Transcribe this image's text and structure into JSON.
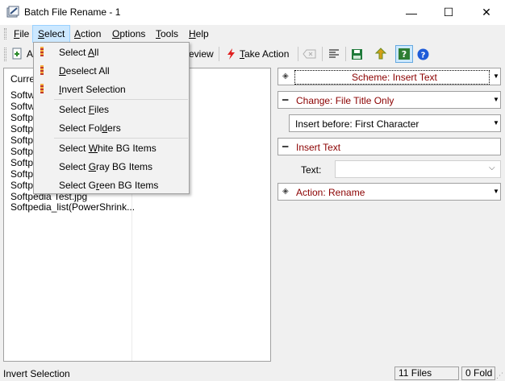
{
  "window": {
    "title": "Batch File Rename - 1",
    "controls": {
      "minimize": "—",
      "maximize": "☐",
      "close": "✕"
    }
  },
  "menubar": {
    "items": [
      {
        "pre": "",
        "key": "F",
        "post": "ile"
      },
      {
        "pre": "",
        "key": "S",
        "post": "elect"
      },
      {
        "pre": "",
        "key": "A",
        "post": "ction"
      },
      {
        "pre": "",
        "key": "O",
        "post": "ptions"
      },
      {
        "pre": "",
        "key": "T",
        "post": "ools"
      },
      {
        "pre": "",
        "key": "H",
        "post": "elp"
      }
    ]
  },
  "toolbar": {
    "add_label_visible": "A",
    "preview_label_visible": "eview",
    "take_action": {
      "pre": "",
      "key": "T",
      "post": "ake Action"
    }
  },
  "file_list": {
    "header_visible": "Curre",
    "rows": [
      "Softw",
      "Softw",
      "Softp",
      "Softp",
      "Softp",
      "Softp",
      "Softp",
      "Softp",
      "Softp",
      "Softpedia Test.jpg",
      "Softpedia_list(PowerShrink..."
    ]
  },
  "select_menu": {
    "items": [
      {
        "pre": "Select ",
        "key": "A",
        "post": "ll"
      },
      {
        "pre": "",
        "key": "D",
        "post": "eselect All"
      },
      {
        "pre": "",
        "key": "I",
        "post": "nvert Selection"
      },
      {
        "pre": "Select ",
        "key": "F",
        "post": "iles"
      },
      {
        "pre": "Select Fol",
        "key": "d",
        "post": "ers"
      },
      {
        "pre": "Select ",
        "key": "W",
        "post": "hite BG Items"
      },
      {
        "pre": "Select ",
        "key": "G",
        "post": "ray BG Items"
      },
      {
        "pre": "Select G",
        "key": "r",
        "post": "een BG Items"
      }
    ]
  },
  "right_panel": {
    "scheme": "Scheme: Insert Text",
    "change": "Change: File Title Only",
    "insert_position": "Insert before: First Character",
    "insert_text_header": "Insert Text",
    "text_label": "Text:",
    "text_value": "",
    "action": "Action: Rename"
  },
  "statusbar": {
    "message": "Invert Selection",
    "files": "11 Files",
    "folders": "0 Fold"
  },
  "colors": {
    "section_label": "#8b0000",
    "menu_highlight": "#cce8ff",
    "take_action_icon": "#e02020",
    "save_icon": "#1f7a3a",
    "help_icon": "#1e5bd8"
  }
}
